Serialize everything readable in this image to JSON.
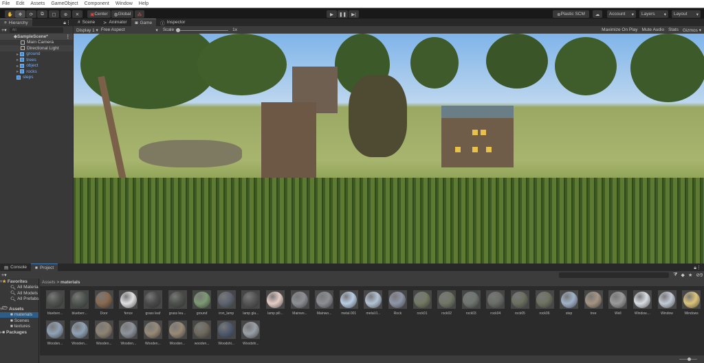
{
  "menu": [
    "File",
    "Edit",
    "Assets",
    "GameObject",
    "Component",
    "Window",
    "Help"
  ],
  "toolbar": {
    "center": "Center",
    "global": "Global",
    "plastic": "Plastic SCM",
    "account": "Account",
    "layers": "Layers",
    "layout": "Layout"
  },
  "hierarchy": {
    "tab": "Hierarchy",
    "search_placeholder": "All",
    "scene": "SampleScene*",
    "items": [
      {
        "label": "Main Camera",
        "prefab": false
      },
      {
        "label": "Directional Light",
        "prefab": false
      },
      {
        "label": "ground",
        "prefab": true
      },
      {
        "label": "trees",
        "prefab": true
      },
      {
        "label": "object",
        "prefab": true
      },
      {
        "label": "rocks",
        "prefab": true
      },
      {
        "label": "steps",
        "prefab": true
      }
    ]
  },
  "view_tabs": [
    "Scene",
    "Animator",
    "Game",
    "Inspector"
  ],
  "game": {
    "display": "Display 1",
    "aspect": "Free Aspect",
    "scale_label": "Scale",
    "scale_value": "1x",
    "maximize": "Maximize On Play",
    "mute": "Mute Audio",
    "stats": "Stats",
    "gizmos": "Gizmos"
  },
  "bottom_tabs": [
    "Console",
    "Project"
  ],
  "project": {
    "favorites": "Favorites",
    "fav_items": [
      "All Materia",
      "All Models",
      "All Prefabs"
    ],
    "assets": "Assets",
    "asset_folders": [
      "materials",
      "Scenes",
      "textures"
    ],
    "packages": "Packages",
    "breadcrumb_root": "Assets",
    "breadcrumb_current": "materials",
    "hidden_count": "9",
    "materials": [
      {
        "name": "blueberr...",
        "color": "#4e514d"
      },
      {
        "name": "blueberr...",
        "color": "#505650"
      },
      {
        "name": "Door",
        "color": "#8a6a4f"
      },
      {
        "name": "fence",
        "color": "#e0e0e2"
      },
      {
        "name": "grass leaf",
        "color": "#4a4a4a"
      },
      {
        "name": "grass lea...",
        "color": "#4d514b"
      },
      {
        "name": "ground",
        "color": "#7d9a72"
      },
      {
        "name": "iron_lamp",
        "color": "#5d6470"
      },
      {
        "name": "lamp gla...",
        "color": "#555"
      },
      {
        "name": "lamp pill...",
        "color": "#e6cdc6"
      },
      {
        "name": "Mainwo...",
        "color": "#8d8f96"
      },
      {
        "name": "Mainwo...",
        "color": "#8d8f96"
      },
      {
        "name": "metal.001",
        "color": "#b9cde4"
      },
      {
        "name": "metal.0...",
        "color": "#b3c4d6"
      },
      {
        "name": "Rock",
        "color": "#8e96a8"
      },
      {
        "name": "rock01",
        "color": "#737a62"
      },
      {
        "name": "rock02",
        "color": "#717766"
      },
      {
        "name": "rock03",
        "color": "#6f766f"
      },
      {
        "name": "rock04",
        "color": "#6a6e67"
      },
      {
        "name": "rock05",
        "color": "#6b7060"
      },
      {
        "name": "rock06",
        "color": "#6e7260"
      },
      {
        "name": "step",
        "color": "#a0b2c9"
      },
      {
        "name": "tree",
        "color": "#a79582"
      },
      {
        "name": "Well",
        "color": "#9a9a9a"
      },
      {
        "name": "Window....",
        "color": "#d8dde4"
      },
      {
        "name": "Window",
        "color": "#c2cad6"
      },
      {
        "name": "Windows",
        "color": "#dcc47a"
      },
      {
        "name": "Wooden...",
        "color": "#8fa2b6"
      },
      {
        "name": "Wooden...",
        "color": "#8fa2b6"
      },
      {
        "name": "Wooden...",
        "color": "#8f8473"
      },
      {
        "name": "Wooden...",
        "color": "#8f939c"
      },
      {
        "name": "Wooden...",
        "color": "#988a76"
      },
      {
        "name": "Wooden...",
        "color": "#988a76"
      },
      {
        "name": "wooden...",
        "color": "#6f6a5e"
      },
      {
        "name": "Woodshi...",
        "color": "#4f5a6e"
      },
      {
        "name": "Woodshi...",
        "color": "#9aa0a8"
      }
    ]
  }
}
